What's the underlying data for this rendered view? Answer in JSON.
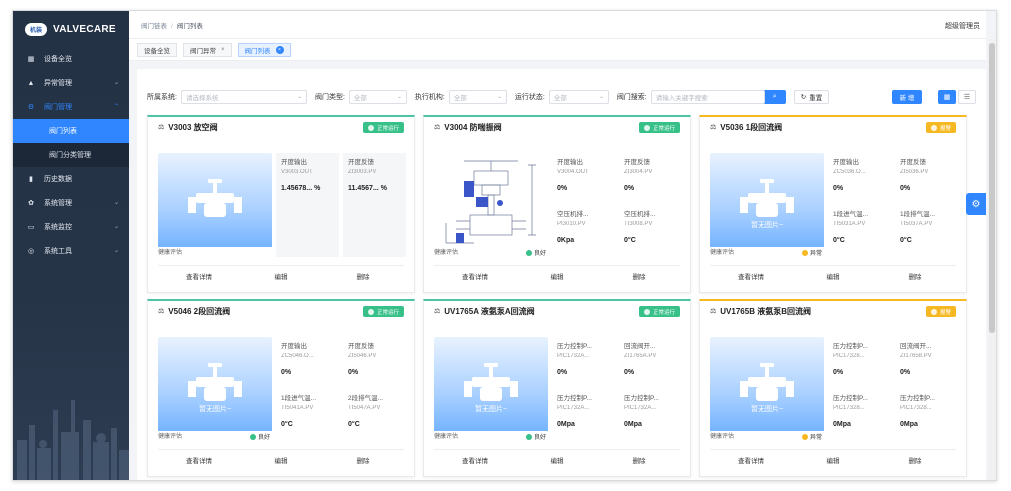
{
  "app": {
    "logo_badge": "机装",
    "name": "VALVECARE"
  },
  "sidebar": {
    "items": [
      {
        "label": "设备全览",
        "icon": "dashboard-icon",
        "glyph": "▦",
        "chev": ""
      },
      {
        "label": "异常管理",
        "icon": "warning-icon",
        "glyph": "▲",
        "chev": "⌄"
      },
      {
        "label": "阀门管理",
        "icon": "valve-settings-icon",
        "glyph": "⚙",
        "chev": "⌃"
      },
      {
        "label": "历史数据",
        "icon": "bar-chart-icon",
        "glyph": "▮",
        "chev": ""
      },
      {
        "label": "系统管理",
        "icon": "gear-icon",
        "glyph": "✿",
        "chev": "⌄"
      },
      {
        "label": "系统监控",
        "icon": "monitor-icon",
        "glyph": "▭",
        "chev": "⌄"
      },
      {
        "label": "系统工具",
        "icon": "tools-icon",
        "glyph": "◎",
        "chev": "⌄"
      }
    ],
    "subitems": [
      {
        "label": "阀门列表"
      },
      {
        "label": "阀门分类管理"
      }
    ]
  },
  "topbar": {
    "crumb1": "阀门链表",
    "sep": "/",
    "crumb2": "阀门列表",
    "user": "超级管理员"
  },
  "tags": [
    {
      "label": "设备全览",
      "close": ""
    },
    {
      "label": "阀门异常",
      "close": "×"
    },
    {
      "label": "阀门列表",
      "close": "×"
    }
  ],
  "filter": {
    "system_label": "所属系统:",
    "system_placeholder": "请选择系统",
    "type_label": "阀门类型:",
    "type_value": "全部",
    "actuator_label": "执行机构:",
    "actuator_value": "全部",
    "run_label": "运行状态:",
    "run_value": "全部",
    "search_label": "阀门搜索:",
    "search_placeholder": "请输入关键字搜索",
    "reset": "重置",
    "add": "新 增"
  },
  "cards": [
    {
      "title": "V3003 放空阀",
      "status": "正常运行",
      "status_color": "#38c089",
      "no_image": "",
      "health_label": "健康评估",
      "health_value": "",
      "metrics": [
        {
          "name": "开度输出",
          "tag": "V3003.OUT",
          "value": "1.45678... %"
        },
        {
          "name": "开度反馈",
          "tag": "ZI3003.PV",
          "value": "11.4567... %"
        }
      ],
      "actions": [
        "查看详情",
        "编辑",
        "删除"
      ]
    },
    {
      "title": "V3004 防喘振阀",
      "status": "正常运行",
      "status_color": "#38c089",
      "no_image": "",
      "health_label": "健康评估",
      "health_value": "良好",
      "metrics": [
        {
          "name": "开度输出",
          "tag": "V3004.OUT",
          "value": "0%"
        },
        {
          "name": "开度反馈",
          "tag": "ZI3004.PV",
          "value": "0%"
        },
        {
          "name": "空压机排...",
          "tag": "PI3010.PV",
          "value": "0Kpa"
        },
        {
          "name": "空压机排...",
          "tag": "TI3008.PV",
          "value": "0°C"
        }
      ],
      "actions": [
        "查看详情",
        "编辑",
        "删除"
      ]
    },
    {
      "title": "V5036 1段回流阀",
      "status": "报警",
      "status_color": "#f6b923",
      "no_image": "暂无图片~",
      "health_label": "健康评估",
      "health_value": "异常",
      "metrics": [
        {
          "name": "开度输出",
          "tag": "ZC5036.O...",
          "value": "0%"
        },
        {
          "name": "开度反馈",
          "tag": "ZI5036.PV",
          "value": "0%"
        },
        {
          "name": "1段进气温...",
          "tag": "TI5031A.PV",
          "value": "0°C"
        },
        {
          "name": "1段排气温...",
          "tag": "TI5037A.PV",
          "value": "0°C"
        }
      ],
      "actions": [
        "查看详情",
        "编辑",
        "删除"
      ]
    },
    {
      "title": "V5046 2段回流阀",
      "status": "正常运行",
      "status_color": "#38c089",
      "no_image": "暂无图片~",
      "health_label": "健康评估",
      "health_value": "良好",
      "metrics": [
        {
          "name": "开度输出",
          "tag": "ZC5046.O...",
          "value": "0%"
        },
        {
          "name": "开度反馈",
          "tag": "ZI5046.PV",
          "value": "0%"
        },
        {
          "name": "1段进气温...",
          "tag": "TI5041A.PV",
          "value": "0°C"
        },
        {
          "name": "2段排气温...",
          "tag": "TI5047A.PV",
          "value": "0°C"
        }
      ],
      "actions": [
        "查看详情",
        "编辑",
        "删除"
      ]
    },
    {
      "title": "UV1765A 液氨泵A回流阀",
      "status": "正常运行",
      "status_color": "#38c089",
      "no_image": "暂无图片~",
      "health_label": "健康评估",
      "health_value": "良好",
      "metrics": [
        {
          "name": "压力控制P...",
          "tag": "PIC1732A...",
          "value": "0%"
        },
        {
          "name": "回流阀开...",
          "tag": "ZI1765A.PV",
          "value": "0%"
        },
        {
          "name": "压力控制P...",
          "tag": "PIC1732A...",
          "value": "0Mpa"
        },
        {
          "name": "压力控制P...",
          "tag": "PIC1732A...",
          "value": "0Mpa"
        }
      ],
      "actions": [
        "查看详情",
        "编辑",
        "删除"
      ]
    },
    {
      "title": "UV1765B 液氨泵B回流阀",
      "status": "报警",
      "status_color": "#f6b923",
      "no_image": "暂无图片~",
      "health_label": "健康评估",
      "health_value": "异常",
      "metrics": [
        {
          "name": "压力控制P...",
          "tag": "PIC17328...",
          "value": "0%"
        },
        {
          "name": "回流阀开...",
          "tag": "ZI17658.PV",
          "value": "0%"
        },
        {
          "name": "压力控制P...",
          "tag": "PIC17328...",
          "value": "0Mpa"
        },
        {
          "name": "压力控制P...",
          "tag": "PIC17328...",
          "value": "0Mpa"
        }
      ],
      "actions": [
        "查看详情",
        "编辑",
        "删除"
      ]
    }
  ]
}
